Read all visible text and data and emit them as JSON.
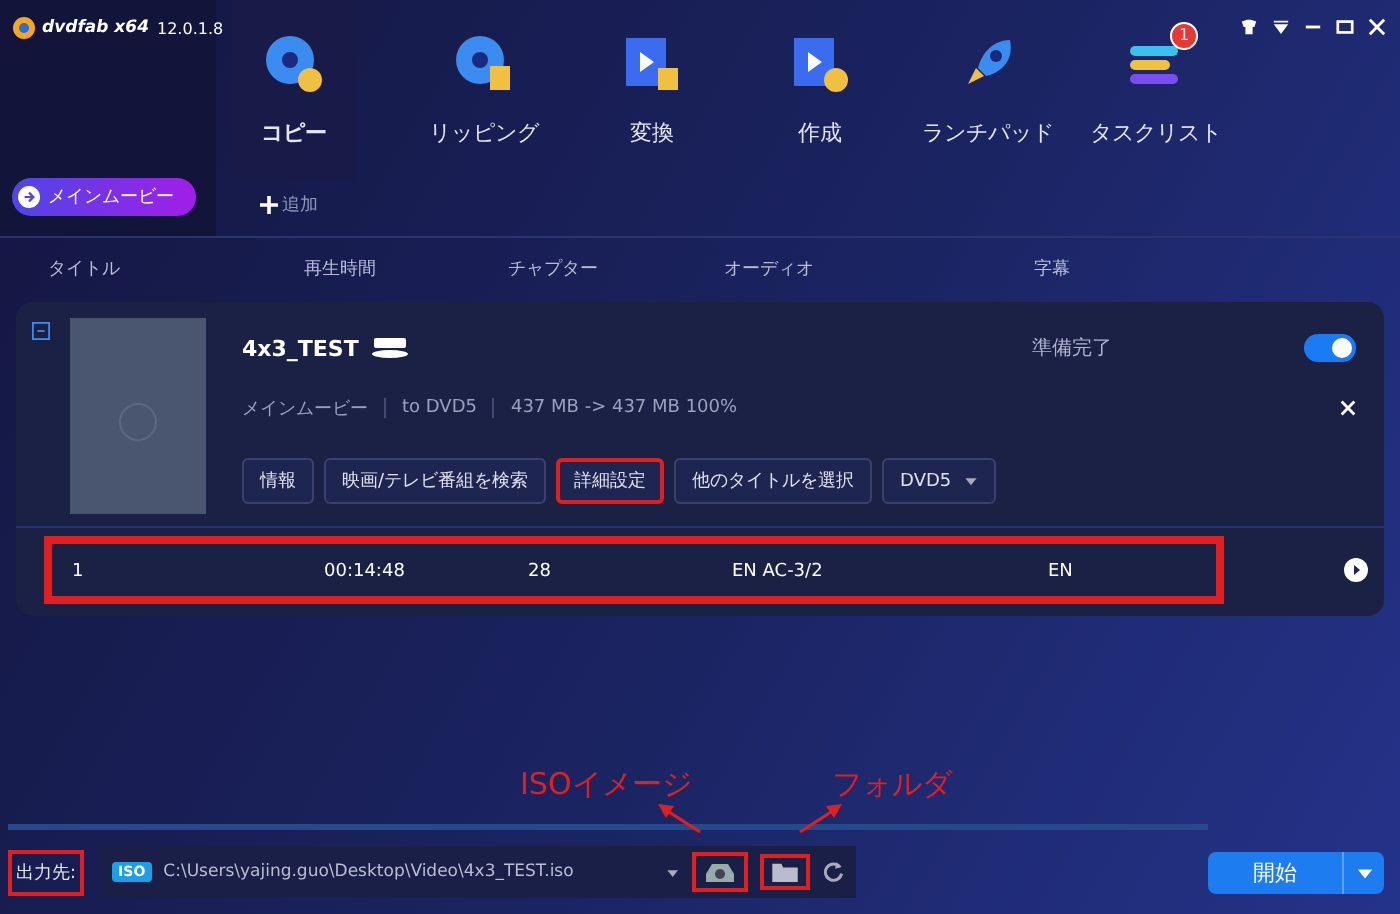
{
  "app": {
    "logo": "dvdfab x64",
    "version": "12.0.1.8"
  },
  "nav": [
    {
      "label": "コピー",
      "selected": true
    },
    {
      "label": "リッピング",
      "selected": false
    },
    {
      "label": "変換",
      "selected": false
    },
    {
      "label": "作成",
      "selected": false
    },
    {
      "label": "ランチパッド",
      "selected": false
    },
    {
      "label": "タスクリスト",
      "selected": false,
      "badge": "1"
    }
  ],
  "mode_button": "メインムービー",
  "add_button": "追加",
  "columns": [
    "タイトル",
    "再生時間",
    "チャプター",
    "オーディオ",
    "字幕"
  ],
  "item": {
    "title": "4x3_TEST",
    "status": "準備完了",
    "enabled": true,
    "meta": [
      "メインムービー",
      "to DVD5",
      "437 MB -> 437 MB 100%"
    ],
    "buttons": [
      {
        "label": "情報",
        "highlighted": false
      },
      {
        "label": "映画/テレビ番組を検索",
        "highlighted": false
      },
      {
        "label": "詳細設定",
        "highlighted": true
      },
      {
        "label": "他のタイトルを選択",
        "highlighted": false
      }
    ],
    "target": "DVD5",
    "row": {
      "cells": [
        "1",
        "00:14:48",
        "28",
        "EN AC-3/2",
        "EN"
      ],
      "highlighted": true
    }
  },
  "output": {
    "label": "出力先:",
    "label_highlighted": true,
    "format": "ISO",
    "path": "C:\\Users\\yajing.guo\\Desktop\\Video\\4x3_TEST.iso",
    "iso_highlighted": true,
    "folder_highlighted": true
  },
  "start_button": "開始",
  "annotations": [
    "ISOイメージ",
    "フォルダ"
  ]
}
